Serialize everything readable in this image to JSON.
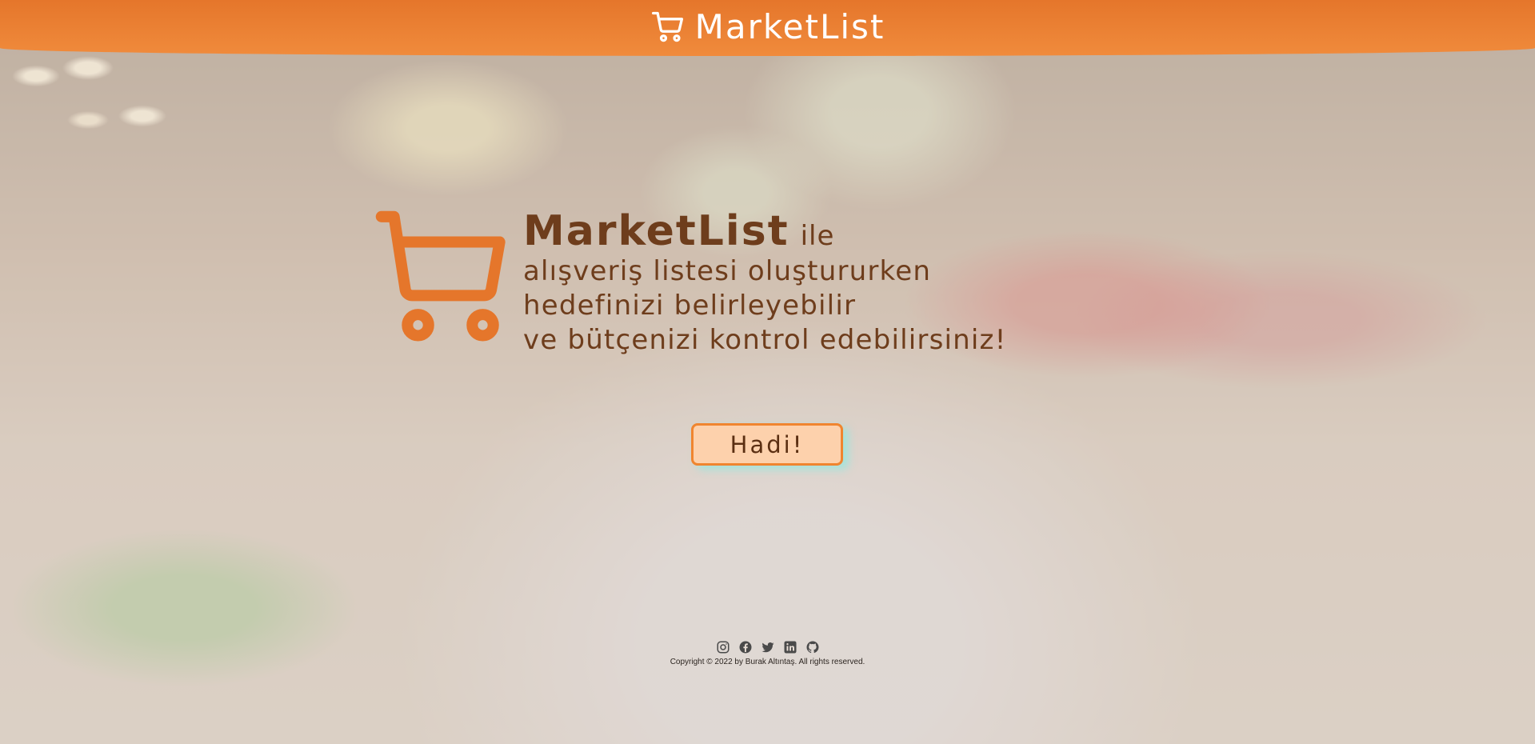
{
  "header": {
    "brand": "MarketList",
    "brand_icon": "cart-icon"
  },
  "hero": {
    "icon": "shopping-cart-icon",
    "brand": "MarketList",
    "ile": "ile",
    "lines": [
      "alışveriş listesi oluştururken",
      "hedefinizi belirleyebilir",
      "ve bütçenizi kontrol edebilirsiniz!"
    ]
  },
  "cta": {
    "label": "Hadi!"
  },
  "footer": {
    "social_icons": [
      "instagram-icon",
      "facebook-icon",
      "twitter-icon",
      "linkedin-icon",
      "github-icon"
    ],
    "copyright": "Copyright © 2022 by Burak Altıntaş. All rights reserved."
  },
  "colors": {
    "accent": "#f08b3c",
    "text_brown": "#6e3d1c",
    "button_fill": "#fdd1ac"
  }
}
